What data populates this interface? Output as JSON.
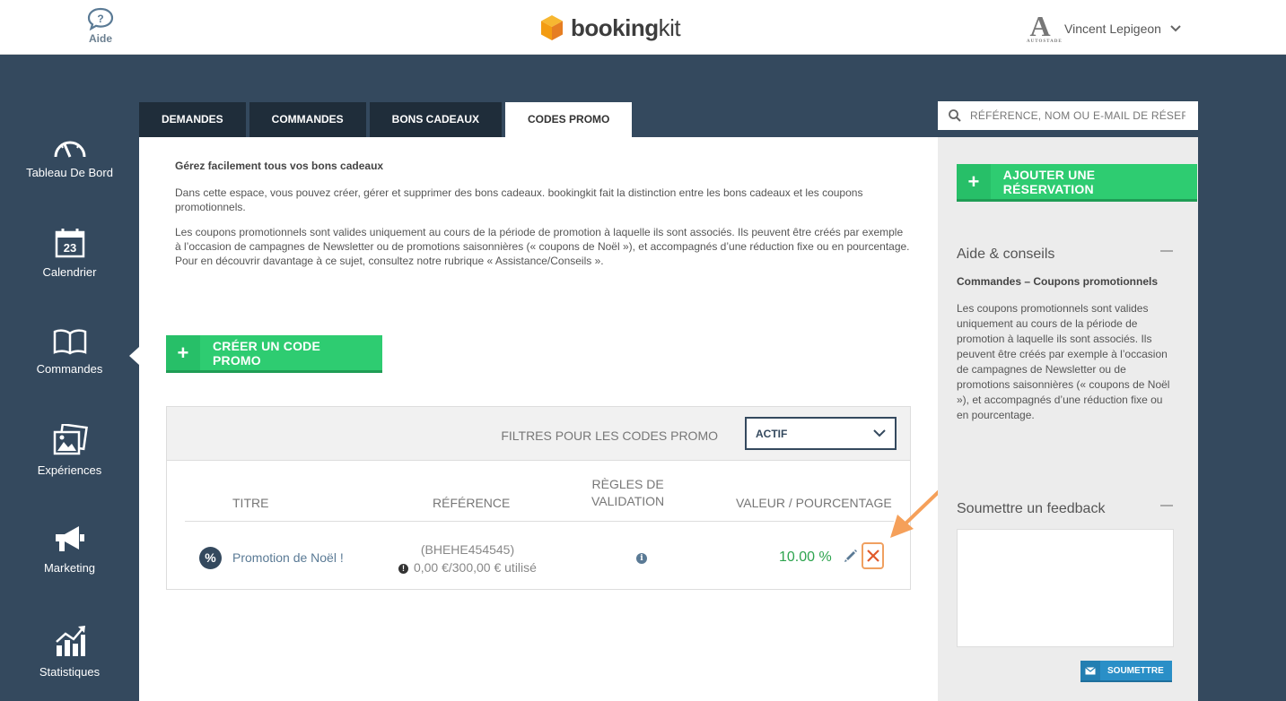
{
  "header": {
    "help_label": "Aide",
    "logo_bold": "booking",
    "logo_light": "kit",
    "user_logo_letter": "A",
    "user_logo_sub": "AUTOSTADE",
    "user_name": "Vincent Lepigeon"
  },
  "nav": {
    "items": [
      {
        "label": "Tableau De Bord",
        "icon": "dashboard-icon"
      },
      {
        "label": "Calendrier",
        "icon": "calendar-icon",
        "day": "23"
      },
      {
        "label": "Commandes",
        "icon": "book-icon"
      },
      {
        "label": "Expériences",
        "icon": "gallery-icon"
      },
      {
        "label": "Marketing",
        "icon": "megaphone-icon"
      },
      {
        "label": "Statistiques",
        "icon": "chart-icon"
      }
    ]
  },
  "tabs": [
    {
      "label": "DEMANDES"
    },
    {
      "label": "COMMANDES"
    },
    {
      "label": "BONS CADEAUX"
    },
    {
      "label": "CODES PROMO",
      "active": true
    }
  ],
  "intro": {
    "title": "Gérez facilement tous vos bons cadeaux",
    "p1": "Dans cette espace, vous pouvez créer, gérer et supprimer des bons cadeaux. bookingkit fait la distinction entre les bons cadeaux et les coupons promotionnels.",
    "p2": "Les coupons promotionnels sont valides uniquement au cours de la période de promotion à laquelle ils sont associés. Ils peuvent être créés par exemple à l’occasion de campagnes de Newsletter ou de promotions saisonnières (« coupons de Noël »), et accompagnés d’une réduction fixe ou en pourcentage. Pour en découvrir davantage à ce sujet, consultez notre rubrique « Assistance/Conseils »."
  },
  "create_button": {
    "label": "CRÉER UN CODE PROMO"
  },
  "filters": {
    "label": "FILTRES POUR LES CODES PROMO",
    "selected": "ACTIF"
  },
  "table": {
    "headers": {
      "title": "TITRE",
      "reference": "RÉFÉRENCE",
      "rules_line1": "RÈGLES DE",
      "rules_line2": "VALIDATION",
      "value": "VALEUR / POURCENTAGE"
    },
    "rows": [
      {
        "icon_text": "%",
        "title": "Promotion de Noël !",
        "reference": "(BHEHE454545)",
        "usage": "0,00 €/300,00 € utilisé",
        "value": "10.00 %"
      }
    ]
  },
  "search": {
    "placeholder": "RÉFÉRENCE, NOM OU E-MAIL DE RÉSERVATION"
  },
  "right": {
    "add_button": "AJOUTER UNE RÉSERVATION",
    "help_title": "Aide & conseils",
    "help_subtitle": "Commandes – Coupons promotionnels",
    "help_text": "Les coupons promotionnels sont valides uniquement au cours de la période de promotion à laquelle ils sont associés. Ils peuvent être créés par exemple à l’occasion de campagnes de Newsletter ou de promotions saisonnières (« coupons de Noël »), et accompagnés d’une réduction fixe ou en pourcentage.",
    "feedback_title": "Soumettre un feedback",
    "submit_label": "SOUMETTRE"
  },
  "colors": {
    "nav_bg": "#34495e",
    "accent_green": "#2ecc71",
    "tab_dark": "#1f2d3a",
    "value_green": "#2ea44f",
    "delete_red": "#e05a2b",
    "annotation_orange": "#f5a05a"
  }
}
